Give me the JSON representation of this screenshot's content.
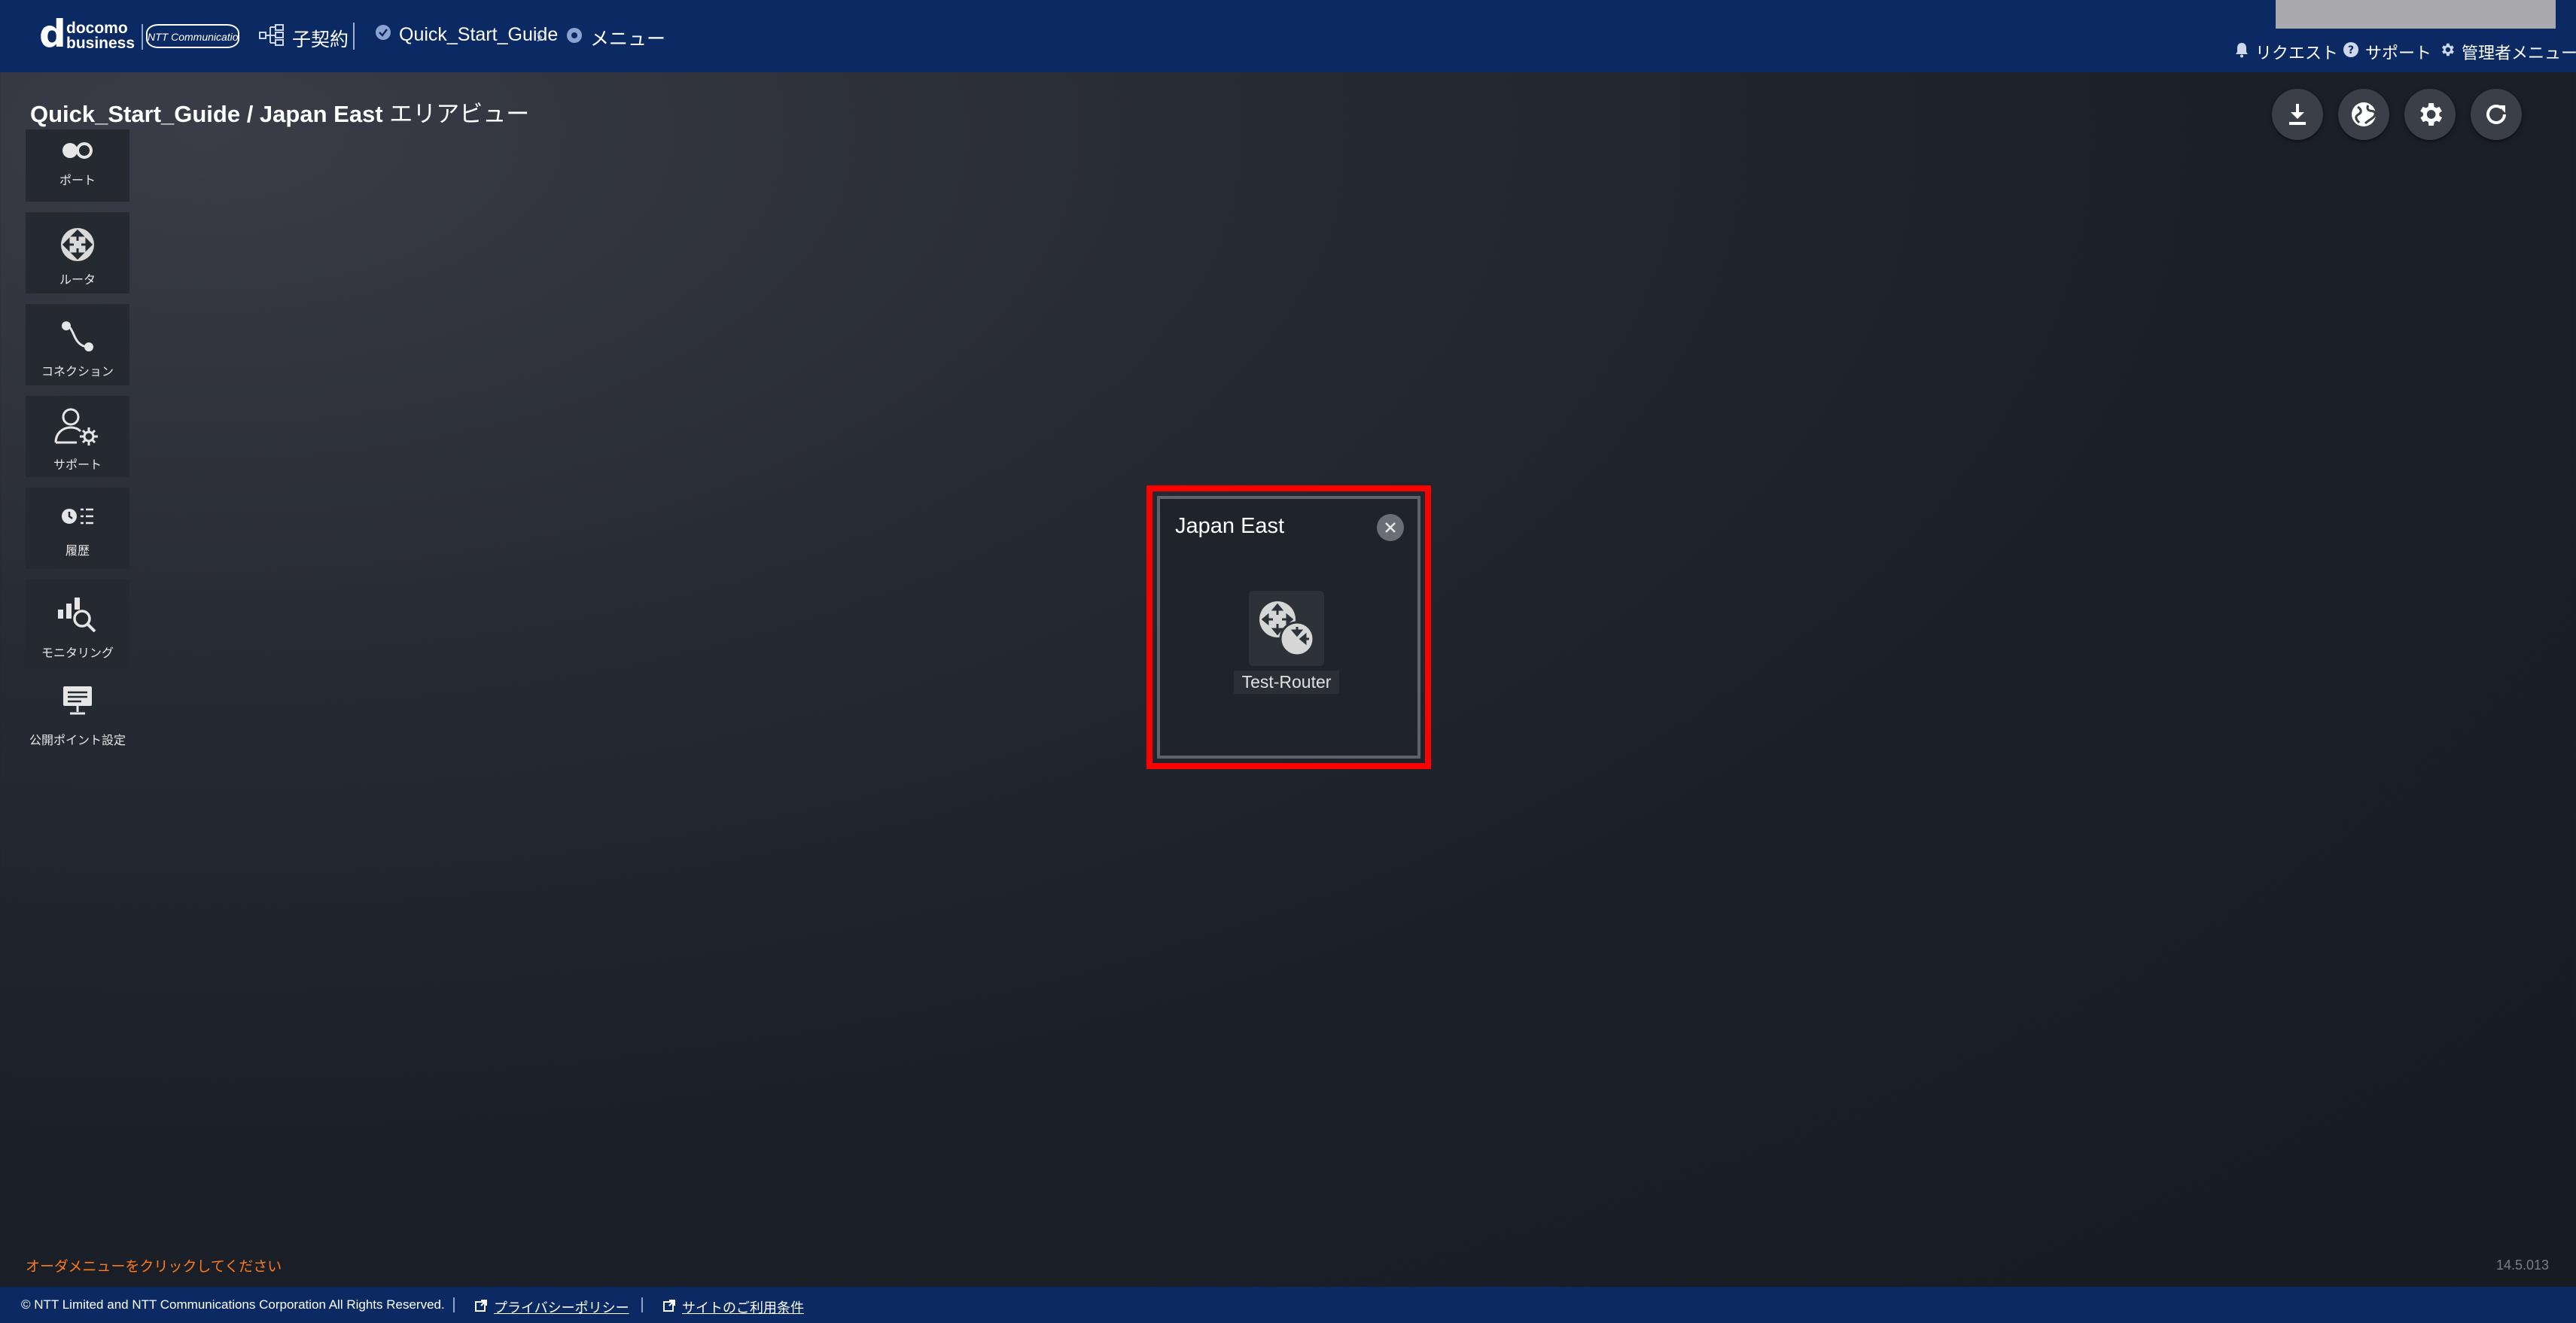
{
  "header": {
    "logo_top": "docomo",
    "logo_bottom": "business",
    "ntt_logo": "NTT Communications",
    "contract_label": "子契約",
    "breadcrumb_guide": "Quick_Start_Guide",
    "breadcrumb_menu": "メニュー",
    "request_label": "リクエスト",
    "support_label": "サポート",
    "admin_label": "管理者メニュー"
  },
  "page": {
    "title_main": "Quick_Start_Guide / Japan East",
    "title_sub": "エリアビュー"
  },
  "sidebar": {
    "items": [
      {
        "label": "ポート",
        "icon": "port-icon"
      },
      {
        "label": "ルータ",
        "icon": "router-icon"
      },
      {
        "label": "コネクション",
        "icon": "connection-icon"
      },
      {
        "label": "サポート",
        "icon": "support-icon"
      },
      {
        "label": "履歴",
        "icon": "history-icon"
      },
      {
        "label": "モニタリング",
        "icon": "monitoring-icon"
      },
      {
        "label": "公開ポイント設定",
        "icon": "public-point-icon"
      }
    ]
  },
  "toolbar": {
    "buttons": [
      "download-icon",
      "globe-icon",
      "gear-icon",
      "refresh-icon"
    ]
  },
  "popup": {
    "title": "Japan East",
    "router_label": "Test-Router"
  },
  "status": {
    "hint": "オーダメニューをクリックしてください",
    "version": "14.5.013"
  },
  "footer": {
    "copyright": "© NTT Limited and NTT Communications Corporation All Rights Reserved.",
    "privacy": "プライバシーポリシー",
    "terms": "サイトのご利用条件"
  },
  "colors": {
    "header_bg": "#0b2a63",
    "highlight": "#ff0000",
    "hint": "#ff7a1a"
  }
}
